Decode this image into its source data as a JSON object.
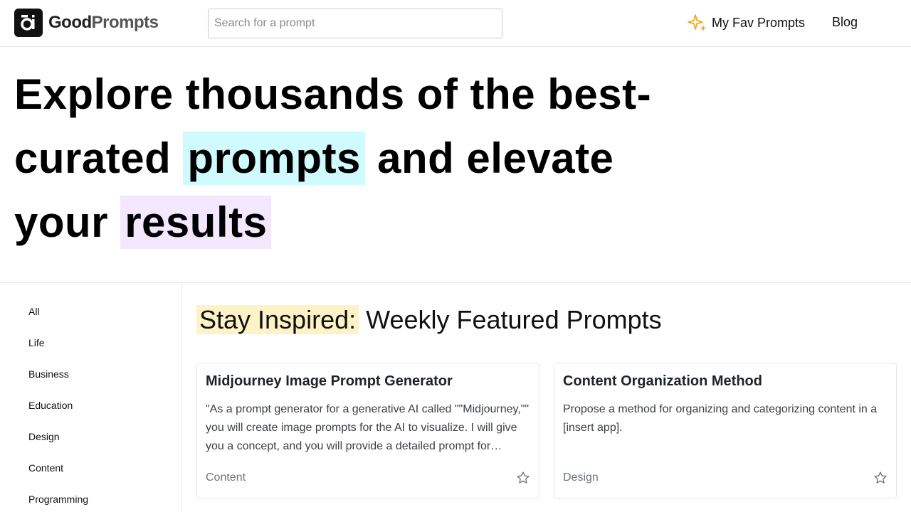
{
  "header": {
    "logo_good": "Good",
    "logo_prompts": "Prompts",
    "search_placeholder": "Search for a prompt",
    "fav_label": "My Fav Prompts",
    "blog_label": "Blog"
  },
  "hero": {
    "part1": "Explore thousands of the best-curated ",
    "highlight1": "prompts",
    "part2": " and elevate your ",
    "highlight2": "results"
  },
  "sidebar": {
    "categories": [
      "All",
      "Life",
      "Business",
      "Education",
      "Design",
      "Content",
      "Programming"
    ]
  },
  "featured": {
    "title_highlight": "Stay Inspired:",
    "title_rest": " Weekly Featured Prompts",
    "cards": [
      {
        "title": "Midjourney Image Prompt Generator",
        "description": "\"As a prompt generator for a generative AI called \"\"Midjourney,\"\" you will create image prompts for the AI to visualize. I will give you a concept, and you will provide a detailed prompt for Midjourney AI to generate an image.",
        "tag": "Content"
      },
      {
        "title": "Content Organization Method",
        "description": "Propose a method for organizing and categorizing content in a [insert app].",
        "tag": "Design"
      }
    ]
  },
  "colors": {
    "highlight_cyan": "#cffafe",
    "highlight_purple": "#f3e8ff",
    "highlight_yellow": "#fef3c7",
    "sparkle": "#f5a623"
  }
}
